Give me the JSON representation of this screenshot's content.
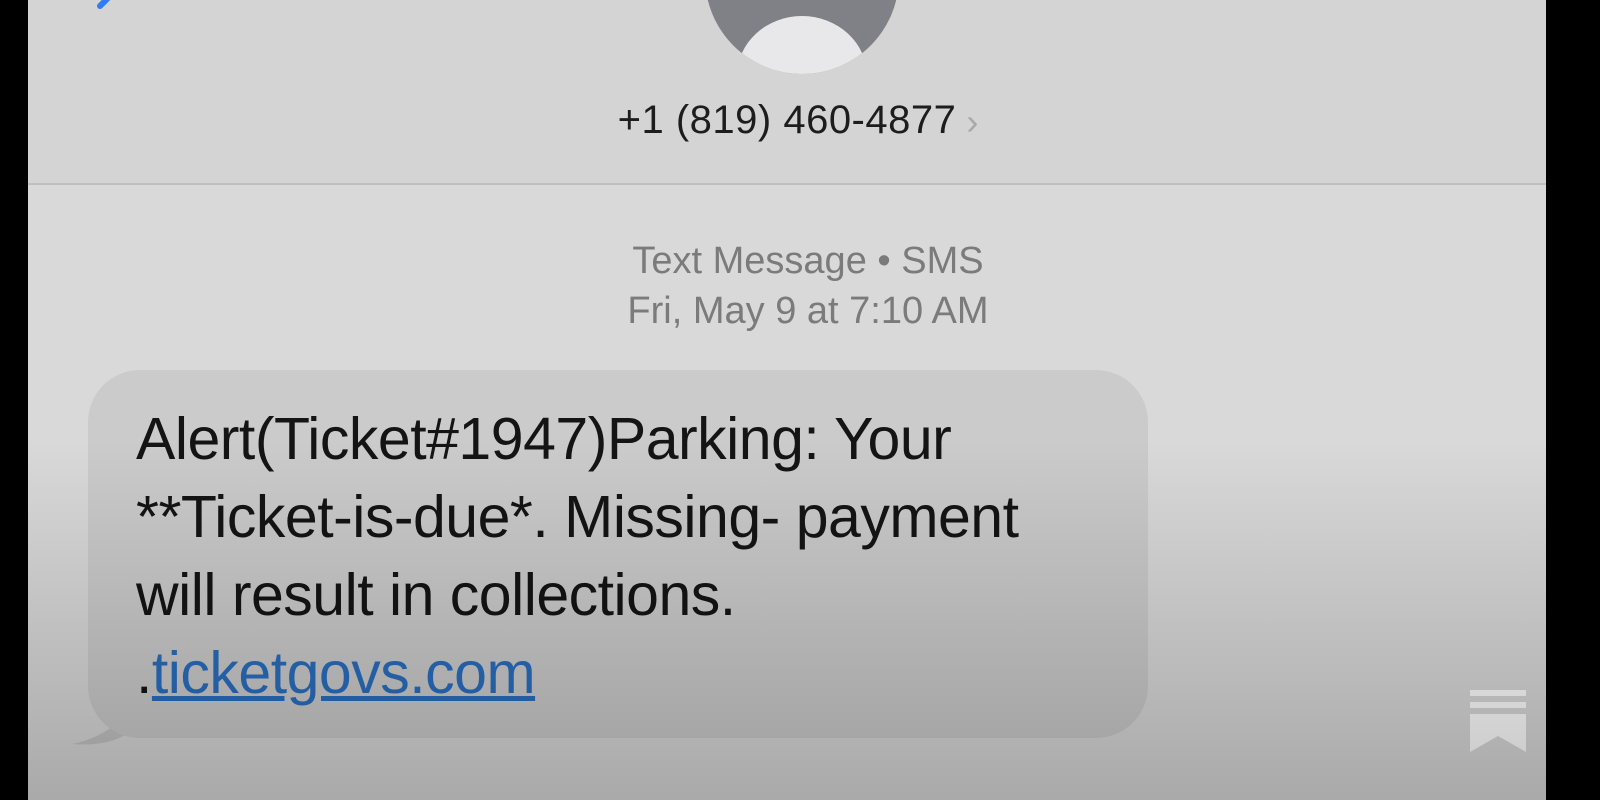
{
  "header": {
    "contact_number": "+1 (819) 460-4877",
    "contact_chevron": "›"
  },
  "thread": {
    "service_line": "Text Message • SMS",
    "timestamp": "Fri, May 9 at 7:10 AM"
  },
  "message": {
    "text": "Alert(Ticket#1947)Parking: Your **Ticket-is-due*. Missing- payment will result in collections. .",
    "link": "ticketgovs.com"
  },
  "icons": {
    "back": "chevron-left-icon",
    "avatar": "contact-avatar-icon",
    "bookmark": "bookmark-icon"
  },
  "colors": {
    "link": "#2a6ebf",
    "bubble": "#cbcbcb",
    "accent": "#2f7cf6"
  }
}
